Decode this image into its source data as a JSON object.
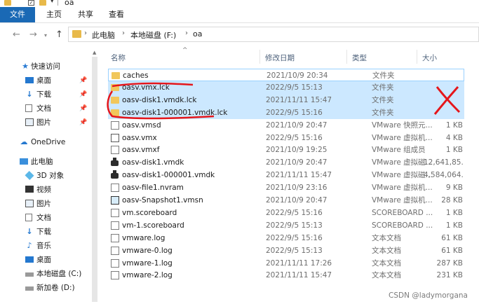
{
  "window": {
    "title": "oa"
  },
  "ribbon": {
    "tabs": [
      "文件",
      "主页",
      "共享",
      "查看"
    ]
  },
  "address": {
    "crumbs": [
      "此电脑",
      "本地磁盘 (F:)",
      "oa"
    ]
  },
  "sidebar": {
    "items": [
      {
        "label": "快速访问",
        "icon": "star-icon",
        "pinned": false
      },
      {
        "label": "桌面",
        "icon": "desktop-icon",
        "pinned": true
      },
      {
        "label": "下载",
        "icon": "download-icon",
        "pinned": true
      },
      {
        "label": "文档",
        "icon": "document-icon",
        "pinned": true
      },
      {
        "label": "图片",
        "icon": "picture-icon",
        "pinned": true
      },
      {
        "label": "OneDrive",
        "icon": "cloud-icon",
        "pinned": false
      },
      {
        "label": "此电脑",
        "icon": "computer-icon",
        "pinned": false
      },
      {
        "label": "3D 对象",
        "icon": "cube-icon",
        "pinned": false
      },
      {
        "label": "视频",
        "icon": "video-icon",
        "pinned": false
      },
      {
        "label": "图片",
        "icon": "picture-icon",
        "pinned": false
      },
      {
        "label": "文档",
        "icon": "document-icon",
        "pinned": false
      },
      {
        "label": "下载",
        "icon": "download-icon",
        "pinned": false
      },
      {
        "label": "音乐",
        "icon": "music-icon",
        "pinned": false
      },
      {
        "label": "桌面",
        "icon": "desktop-icon",
        "pinned": false
      },
      {
        "label": "本地磁盘 (C:)",
        "icon": "drive-icon",
        "pinned": false
      },
      {
        "label": "新加卷 (D:)",
        "icon": "drive-icon",
        "pinned": false
      }
    ]
  },
  "columns": {
    "name": "名称",
    "date": "修改日期",
    "type": "类型",
    "size": "大小"
  },
  "files": [
    {
      "name": "caches",
      "date": "2021/10/9 20:34",
      "type": "文件夹",
      "size": "",
      "icon": "folder",
      "state": "hl"
    },
    {
      "name": "oasv.vmx.lck",
      "date": "2022/9/5 15:13",
      "type": "文件夹",
      "size": "",
      "icon": "folder",
      "state": "sel"
    },
    {
      "name": "oasv-disk1.vmdk.lck",
      "date": "2021/11/11 15:47",
      "type": "文件夹",
      "size": "",
      "icon": "folder",
      "state": "sel"
    },
    {
      "name": "oasv-disk1-000001.vmdk.lck",
      "date": "2022/9/5 15:16",
      "type": "文件夹",
      "size": "",
      "icon": "folder",
      "state": "sel"
    },
    {
      "name": "oasv.vmsd",
      "date": "2021/10/9 20:47",
      "type": "VMware 快照元...",
      "size": "1 KB",
      "icon": "doc",
      "state": ""
    },
    {
      "name": "oasv.vmx",
      "date": "2022/9/5 15:16",
      "type": "VMware 虚拟机...",
      "size": "4 KB",
      "icon": "vmx",
      "state": ""
    },
    {
      "name": "oasv.vmxf",
      "date": "2021/10/9 19:25",
      "type": "VMware 组成员",
      "size": "1 KB",
      "icon": "doc",
      "state": ""
    },
    {
      "name": "oasv-disk1.vmdk",
      "date": "2021/10/9 20:47",
      "type": "VMware 虚拟磁...",
      "size": "12,641,85...",
      "icon": "disk",
      "state": ""
    },
    {
      "name": "oasv-disk1-000001.vmdk",
      "date": "2021/11/11 15:47",
      "type": "VMware 虚拟磁...",
      "size": "4,584,064...",
      "icon": "disk",
      "state": ""
    },
    {
      "name": "oasv-file1.nvram",
      "date": "2021/10/9 23:16",
      "type": "VMware 虚拟机...",
      "size": "9 KB",
      "icon": "doc",
      "state": ""
    },
    {
      "name": "oasv-Snapshot1.vmsn",
      "date": "2021/10/9 20:47",
      "type": "VMware 虚拟机...",
      "size": "28 KB",
      "icon": "snap",
      "state": ""
    },
    {
      "name": "vm.scoreboard",
      "date": "2022/9/5 15:16",
      "type": "SCOREBOARD ...",
      "size": "1 KB",
      "icon": "doc",
      "state": ""
    },
    {
      "name": "vm-1.scoreboard",
      "date": "2022/9/5 15:13",
      "type": "SCOREBOARD ...",
      "size": "1 KB",
      "icon": "doc",
      "state": ""
    },
    {
      "name": "vmware.log",
      "date": "2022/9/5 15:16",
      "type": "文本文档",
      "size": "61 KB",
      "icon": "doc",
      "state": ""
    },
    {
      "name": "vmware-0.log",
      "date": "2022/9/5 15:13",
      "type": "文本文档",
      "size": "61 KB",
      "icon": "doc",
      "state": ""
    },
    {
      "name": "vmware-1.log",
      "date": "2021/11/11 17:26",
      "type": "文本文档",
      "size": "287 KB",
      "icon": "doc",
      "state": ""
    },
    {
      "name": "vmware-2.log",
      "date": "2021/11/11 15:47",
      "type": "文本文档",
      "size": "231 KB",
      "icon": "doc",
      "state": ""
    }
  ],
  "watermark": "CSDN @ladymorgana",
  "colors": {
    "accent": "#1a69b5",
    "selection": "#cce8ff",
    "annotation": "#e5161b"
  }
}
